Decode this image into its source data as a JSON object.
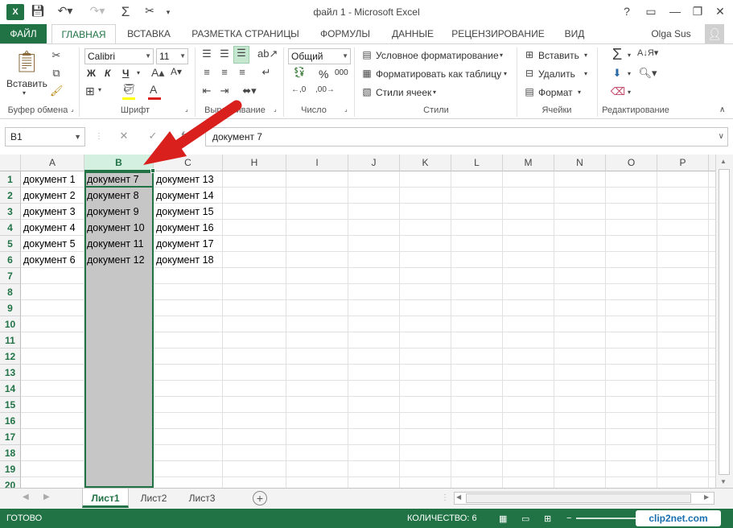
{
  "window": {
    "title": "файл 1 - Microsoft Excel",
    "help_label": "?",
    "minimize_label": "—",
    "restore_label": "❐",
    "close_label": "✕"
  },
  "ribbon_tabs": {
    "file": "ФАЙЛ",
    "items": [
      "ГЛАВНАЯ",
      "ВСТАВКА",
      "РАЗМЕТКА СТРАНИЦЫ",
      "ФОРМУЛЫ",
      "ДАННЫЕ",
      "РЕЦЕНЗИРОВАНИЕ",
      "ВИД"
    ],
    "active": "ГЛАВНАЯ",
    "user_name": "Olga Sus"
  },
  "ribbon": {
    "clipboard": {
      "paste_label": "Вставить",
      "group_label": "Буфер обмена"
    },
    "font": {
      "font_name": "Calibri",
      "font_size": "11",
      "bold": "Ж",
      "italic": "К",
      "underline": "Ч",
      "font_color_glyph": "A",
      "group_label": "Шрифт"
    },
    "alignment": {
      "group_label": "Выравнивание"
    },
    "number": {
      "format": "Общий",
      "percent": "%",
      "thousands": "000",
      "group_label": "Число"
    },
    "styles": {
      "conditional": "Условное форматирование",
      "as_table": "Форматировать как таблицу",
      "cell_styles": "Стили ячеек",
      "group_label": "Стили"
    },
    "cells": {
      "insert": "Вставить",
      "delete": "Удалить",
      "format": "Формат",
      "group_label": "Ячейки"
    },
    "editing": {
      "group_label": "Редактирование"
    }
  },
  "formula_bar": {
    "name_box": "B1",
    "fx": "fx",
    "value": "документ 7"
  },
  "grid": {
    "columns": [
      "A",
      "B",
      "C",
      "H",
      "I",
      "J",
      "K",
      "L",
      "M",
      "N",
      "O",
      "P"
    ],
    "selected_column": "B",
    "rows": [
      "1",
      "2",
      "3",
      "4",
      "5",
      "6",
      "7",
      "8",
      "9",
      "10",
      "11",
      "12",
      "13",
      "14",
      "15",
      "16",
      "17",
      "18",
      "19",
      "20"
    ],
    "cells_a": [
      "документ 1",
      "документ 2",
      "документ 3",
      "документ 4",
      "документ 5",
      "документ 6"
    ],
    "cells_b": [
      "документ 7",
      "документ 8",
      "документ 9",
      "документ 10",
      "документ 11",
      "документ 12"
    ],
    "cells_c": [
      "документ 13",
      "документ 14",
      "документ 15",
      "документ 16",
      "документ 17",
      "документ 18"
    ]
  },
  "sheets": {
    "tabs": [
      "Лист1",
      "Лист2",
      "Лист3"
    ],
    "active": "Лист1",
    "add_label": "+"
  },
  "status_bar": {
    "ready": "ГОТОВО",
    "count": "КОЛИЧЕСТВО: 6",
    "watermark": "clip2net.com"
  },
  "colors": {
    "accent": "#217346",
    "arrow": "#d9201c",
    "selection_fill": "#c6c6c6"
  }
}
